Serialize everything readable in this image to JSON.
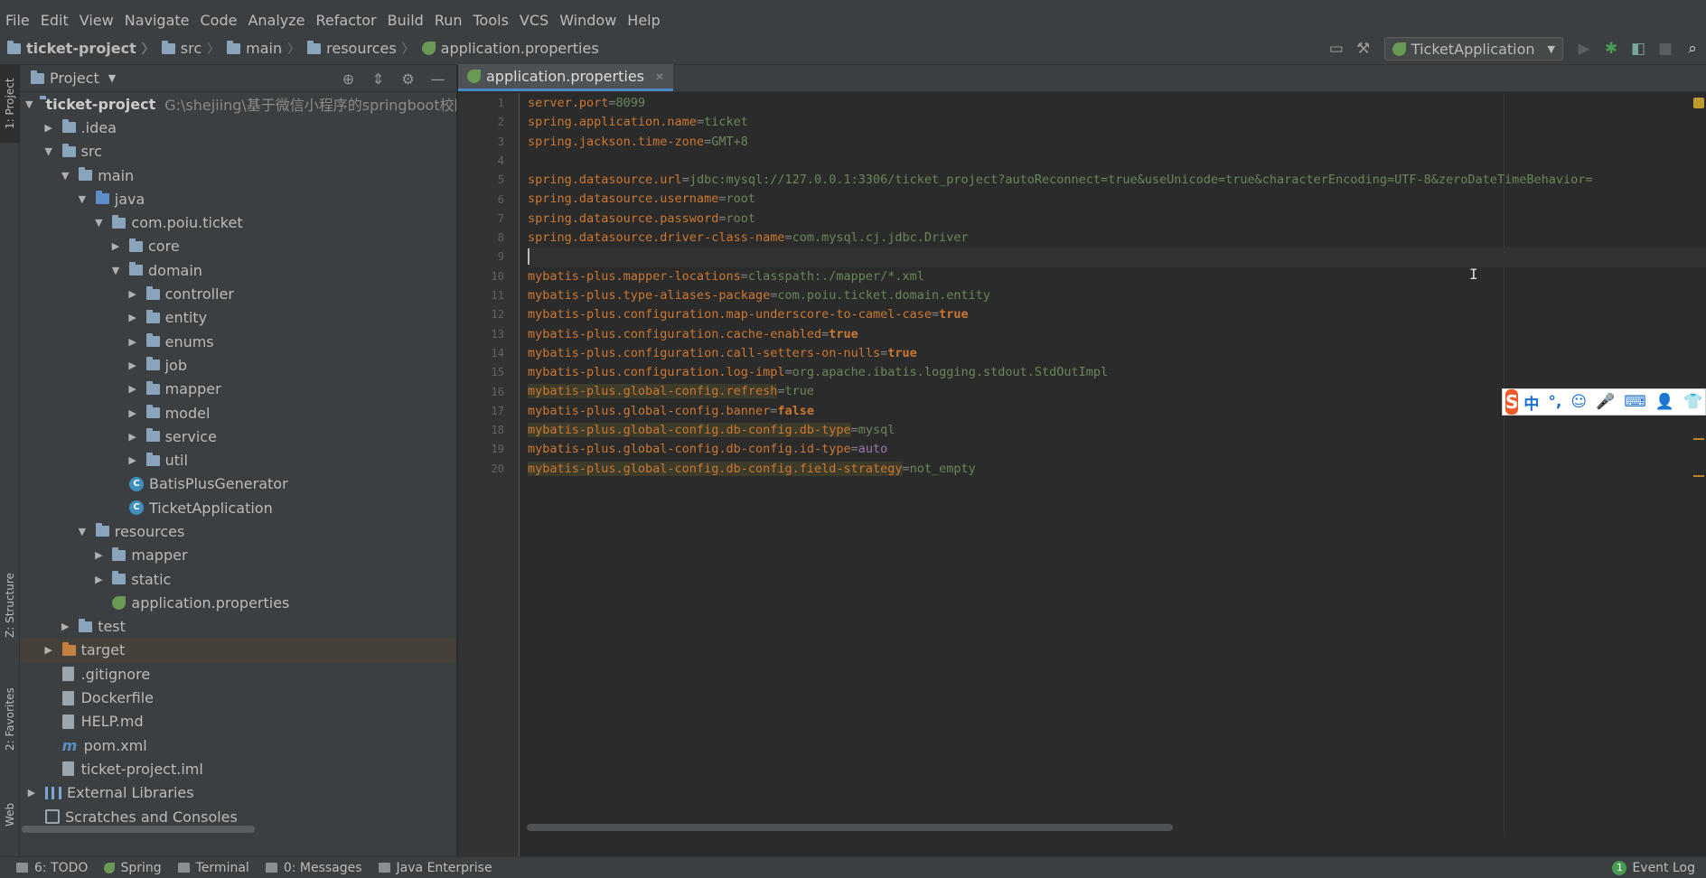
{
  "menubar": {
    "items": [
      "File",
      "Edit",
      "View",
      "Navigate",
      "Code",
      "Analyze",
      "Refactor",
      "Build",
      "Run",
      "Tools",
      "VCS",
      "Window",
      "Help"
    ]
  },
  "navbar": {
    "breadcrumbs": [
      "ticket-project",
      "src",
      "main",
      "resources",
      "application.properties"
    ],
    "run_config": "TicketApplication"
  },
  "left_strip": {
    "tabs": [
      "1: Project",
      "Z: Structure",
      "2: Favorites",
      "Web"
    ]
  },
  "project_panel": {
    "title": "Project",
    "root": {
      "name": "ticket-project",
      "path": "G:\\shejiing\\基于微信小程序的springboot校园"
    },
    "tree": [
      {
        "label": ".idea",
        "depth": 1,
        "arrow": "▶",
        "icon": "folder-icon"
      },
      {
        "label": "src",
        "depth": 1,
        "arrow": "▼",
        "icon": "folder-icon"
      },
      {
        "label": "main",
        "depth": 2,
        "arrow": "▼",
        "icon": "folder-icon"
      },
      {
        "label": "java",
        "depth": 3,
        "arrow": "▼",
        "icon": "source-folder-icon"
      },
      {
        "label": "com.poiu.ticket",
        "depth": 4,
        "arrow": "▼",
        "icon": "package-icon"
      },
      {
        "label": "core",
        "depth": 5,
        "arrow": "▶",
        "icon": "package-icon"
      },
      {
        "label": "domain",
        "depth": 5,
        "arrow": "▼",
        "icon": "package-icon"
      },
      {
        "label": "controller",
        "depth": 6,
        "arrow": "▶",
        "icon": "package-icon"
      },
      {
        "label": "entity",
        "depth": 6,
        "arrow": "▶",
        "icon": "package-icon"
      },
      {
        "label": "enums",
        "depth": 6,
        "arrow": "▶",
        "icon": "package-icon"
      },
      {
        "label": "job",
        "depth": 6,
        "arrow": "▶",
        "icon": "package-icon"
      },
      {
        "label": "mapper",
        "depth": 6,
        "arrow": "▶",
        "icon": "package-icon"
      },
      {
        "label": "model",
        "depth": 6,
        "arrow": "▶",
        "icon": "package-icon"
      },
      {
        "label": "service",
        "depth": 6,
        "arrow": "▶",
        "icon": "package-icon"
      },
      {
        "label": "util",
        "depth": 6,
        "arrow": "▶",
        "icon": "package-icon"
      },
      {
        "label": "BatisPlusGenerator",
        "depth": 5,
        "arrow": "",
        "icon": "class-icon"
      },
      {
        "label": "TicketApplication",
        "depth": 5,
        "arrow": "",
        "icon": "class-icon"
      },
      {
        "label": "resources",
        "depth": 3,
        "arrow": "▼",
        "icon": "resources-folder-icon"
      },
      {
        "label": "mapper",
        "depth": 4,
        "arrow": "▶",
        "icon": "folder-icon"
      },
      {
        "label": "static",
        "depth": 4,
        "arrow": "▶",
        "icon": "folder-icon"
      },
      {
        "label": "application.properties",
        "depth": 4,
        "arrow": "",
        "icon": "spring-properties-icon"
      },
      {
        "label": "test",
        "depth": 2,
        "arrow": "▶",
        "icon": "folder-icon"
      },
      {
        "label": "target",
        "depth": 1,
        "arrow": "▶",
        "icon": "excluded-folder-icon",
        "selected": true
      },
      {
        "label": ".gitignore",
        "depth": 1,
        "arrow": "",
        "icon": "file-icon"
      },
      {
        "label": "Dockerfile",
        "depth": 1,
        "arrow": "",
        "icon": "file-icon"
      },
      {
        "label": "HELP.md",
        "depth": 1,
        "arrow": "",
        "icon": "markdown-icon"
      },
      {
        "label": "pom.xml",
        "depth": 1,
        "arrow": "",
        "icon": "maven-icon"
      },
      {
        "label": "ticket-project.iml",
        "depth": 1,
        "arrow": "",
        "icon": "file-icon"
      },
      {
        "label": "External Libraries",
        "depth": 0,
        "arrow": "▶",
        "icon": "library-icon"
      },
      {
        "label": "Scratches and Consoles",
        "depth": 0,
        "arrow": "",
        "icon": "scratches-icon"
      }
    ]
  },
  "editor": {
    "tab": "application.properties",
    "lines": [
      {
        "key": "server.port",
        "value": "8099"
      },
      {
        "key": "spring.application.name",
        "value": "ticket"
      },
      {
        "key": "spring.jackson.time-zone",
        "value": "GMT+8"
      },
      {
        "key": "",
        "value": ""
      },
      {
        "key": "spring.datasource.url",
        "value": "jdbc:mysql://127.0.0.1:3306/ticket_project?autoReconnect=true&useUnicode=true&characterEncoding=UTF-8&zeroDateTimeBehavior="
      },
      {
        "key": "spring.datasource.username",
        "value": "root"
      },
      {
        "key": "spring.datasource.password",
        "value": "root"
      },
      {
        "key": "spring.datasource.driver-class-name",
        "value": "com.mysql.cj.jdbc.Driver"
      },
      {
        "key": "",
        "value": "",
        "current": true
      },
      {
        "key": "mybatis-plus.mapper-locations",
        "value": "classpath:./mapper/*.xml"
      },
      {
        "key": "mybatis-plus.type-aliases-package",
        "value": "com.poiu.ticket.domain.entity"
      },
      {
        "key": "mybatis-plus.configuration.map-underscore-to-camel-case",
        "value": "true",
        "style": "bool"
      },
      {
        "key": "mybatis-plus.configuration.cache-enabled",
        "value": "true",
        "style": "bool"
      },
      {
        "key": "mybatis-plus.configuration.call-setters-on-nulls",
        "value": "true",
        "style": "bool"
      },
      {
        "key": "mybatis-plus.configuration.log-impl",
        "value": "org.apache.ibatis.logging.stdout.StdOutImpl"
      },
      {
        "key": "mybatis-plus.global-config.refresh",
        "value": "true",
        "highlight": true
      },
      {
        "key": "mybatis-plus.global-config.banner",
        "value": "false",
        "style": "bool"
      },
      {
        "key": "mybatis-plus.global-config.db-config.db-type",
        "value": "mysql",
        "highlight": true
      },
      {
        "key": "mybatis-plus.global-config.db-config.id-type",
        "value": "auto",
        "style": "purple"
      },
      {
        "key": "mybatis-plus.global-config.db-config.field-strategy",
        "value": "not_empty",
        "highlight": true
      }
    ]
  },
  "ime": {
    "logo": "S",
    "items": [
      "中",
      "°,",
      "☺",
      "🎤",
      "⌨",
      "👤",
      "👕"
    ]
  },
  "statusbar": {
    "items": [
      "6: TODO",
      "Spring",
      "Terminal",
      "0: Messages",
      "Java Enterprise"
    ],
    "event_log": "Event Log",
    "event_count": "1"
  },
  "colors": {
    "key": "#cc7832",
    "value": "#6a8759",
    "selection": "#45403a",
    "tab_underline": "#4a88c7"
  }
}
